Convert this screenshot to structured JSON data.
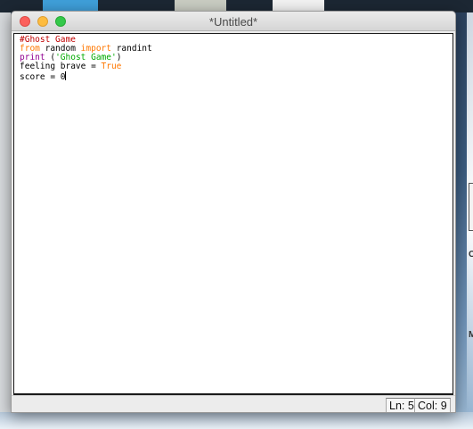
{
  "window": {
    "title": "*Untitled*"
  },
  "editor": {
    "lines": [
      [
        {
          "text": "#Ghost Game",
          "color": "#c00000"
        }
      ],
      [
        {
          "text": "from",
          "color": "#ff7700"
        },
        {
          "text": " random ",
          "color": "#000000"
        },
        {
          "text": "import",
          "color": "#ff7700"
        },
        {
          "text": " randint",
          "color": "#000000"
        }
      ],
      [
        {
          "text": "print",
          "color": "#900090"
        },
        {
          "text": " (",
          "color": "#000000"
        },
        {
          "text": "'Ghost Game'",
          "color": "#00aa00"
        },
        {
          "text": ")",
          "color": "#000000"
        }
      ],
      [
        {
          "text": "feeling brave = ",
          "color": "#000000"
        },
        {
          "text": "True",
          "color": "#ff7700"
        }
      ],
      [
        {
          "text": "score = 0",
          "color": "#000000"
        }
      ]
    ]
  },
  "status": {
    "line": "Ln: 5",
    "column": "Col: 9"
  },
  "desktop": {
    "peek_letter_1": "C",
    "peek_letter_2": "M"
  }
}
